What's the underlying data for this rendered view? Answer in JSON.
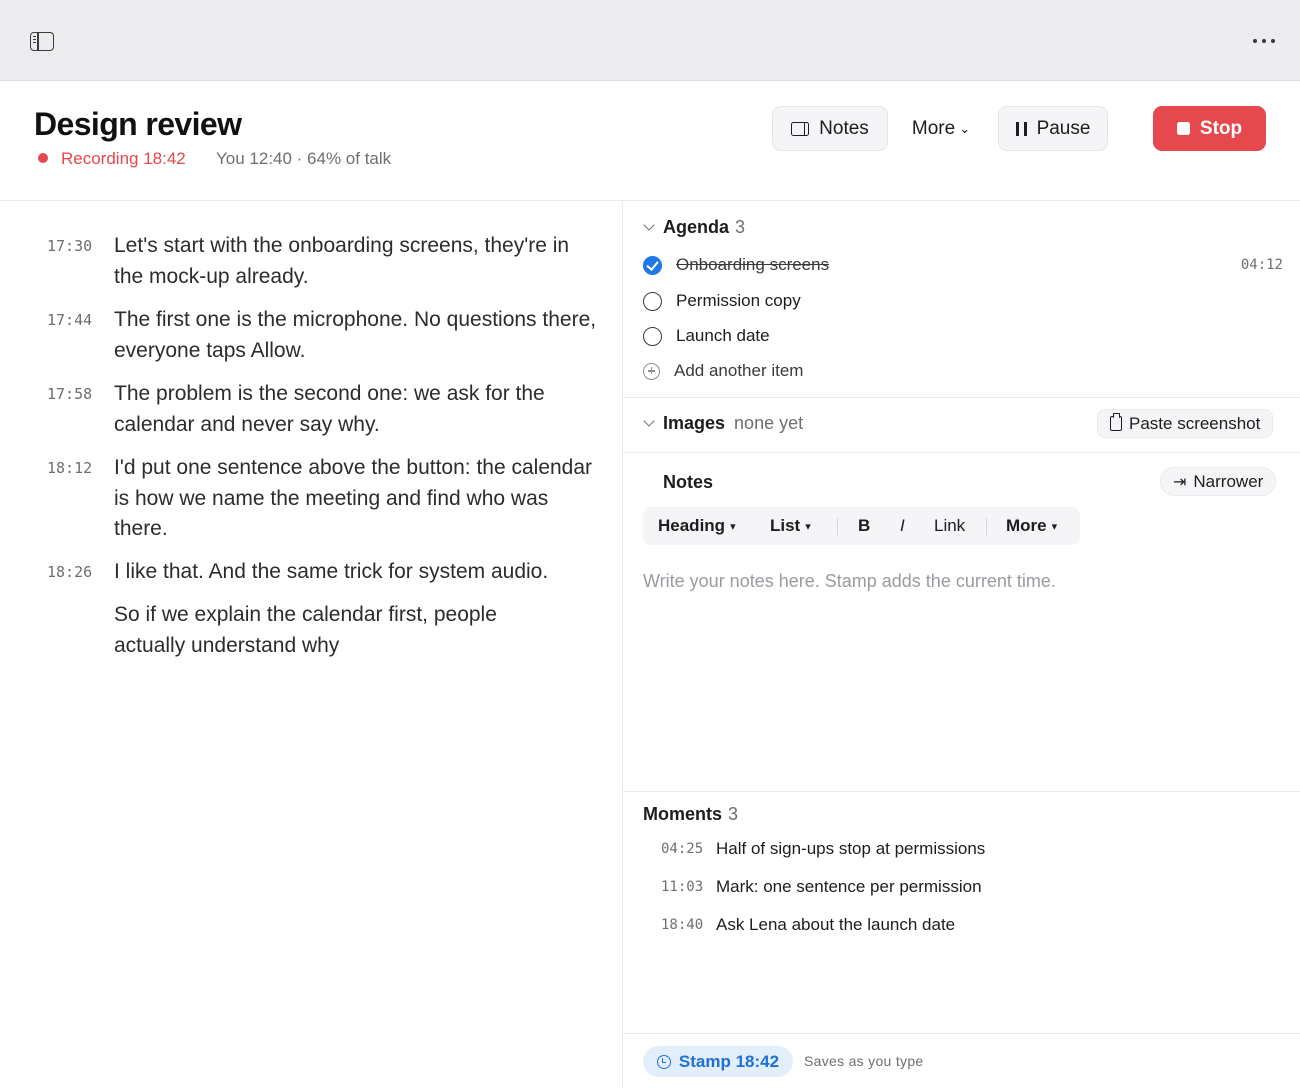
{
  "header": {
    "title": "Design review",
    "recording": "Recording 18:42",
    "talk_stats": "You 12:40 · 64% of talk",
    "notes_button": "Notes",
    "more_button": "More",
    "pause_button": "Pause",
    "stop_button": "Stop"
  },
  "transcript": [
    {
      "time": "17:30",
      "text": "Let's start with the onboarding screens, they're in the mock-up already."
    },
    {
      "time": "17:44",
      "text": "The first one is the microphone. No questions there, everyone taps Allow."
    },
    {
      "time": "17:58",
      "text": "The problem is the second one: we ask for the calendar and never say why."
    },
    {
      "time": "18:12",
      "text": "I'd put one sentence above the button: the calendar is how we name the meeting and find who was there."
    },
    {
      "time": "18:26",
      "text": "I like that. And the same trick for system audio."
    },
    {
      "time": "",
      "text": "So if we explain the calendar first, people actually understand why"
    }
  ],
  "agenda": {
    "title": "Agenda",
    "count": "3",
    "items": [
      {
        "label": "Onboarding screens",
        "done": true,
        "time": "04:12"
      },
      {
        "label": "Permission copy",
        "done": false,
        "time": ""
      },
      {
        "label": "Launch date",
        "done": false,
        "time": ""
      }
    ],
    "add_label": "Add another item"
  },
  "images": {
    "title": "Images",
    "status": "none yet",
    "paste_button": "Paste screenshot"
  },
  "notes": {
    "title": "Notes",
    "narrower_button": "Narrower",
    "toolbar": {
      "heading": "Heading",
      "list": "List",
      "bold": "B",
      "italic": "I",
      "link": "Link",
      "more": "More"
    },
    "placeholder": "Write your notes here. Stamp adds the current time."
  },
  "moments": {
    "title": "Moments",
    "count": "3",
    "items": [
      {
        "time": "04:25",
        "text": "Half of sign-ups stop at permissions"
      },
      {
        "time": "11:03",
        "text": "Mark: one sentence per permission"
      },
      {
        "time": "18:40",
        "text": "Ask Lena about the launch date"
      }
    ]
  },
  "footer": {
    "stamp_button": "Stamp 18:42",
    "save_status": "Saves as you type"
  },
  "colors": {
    "accent": "#1f78e6",
    "recording": "#e5484d",
    "stop": "#e5484d"
  }
}
